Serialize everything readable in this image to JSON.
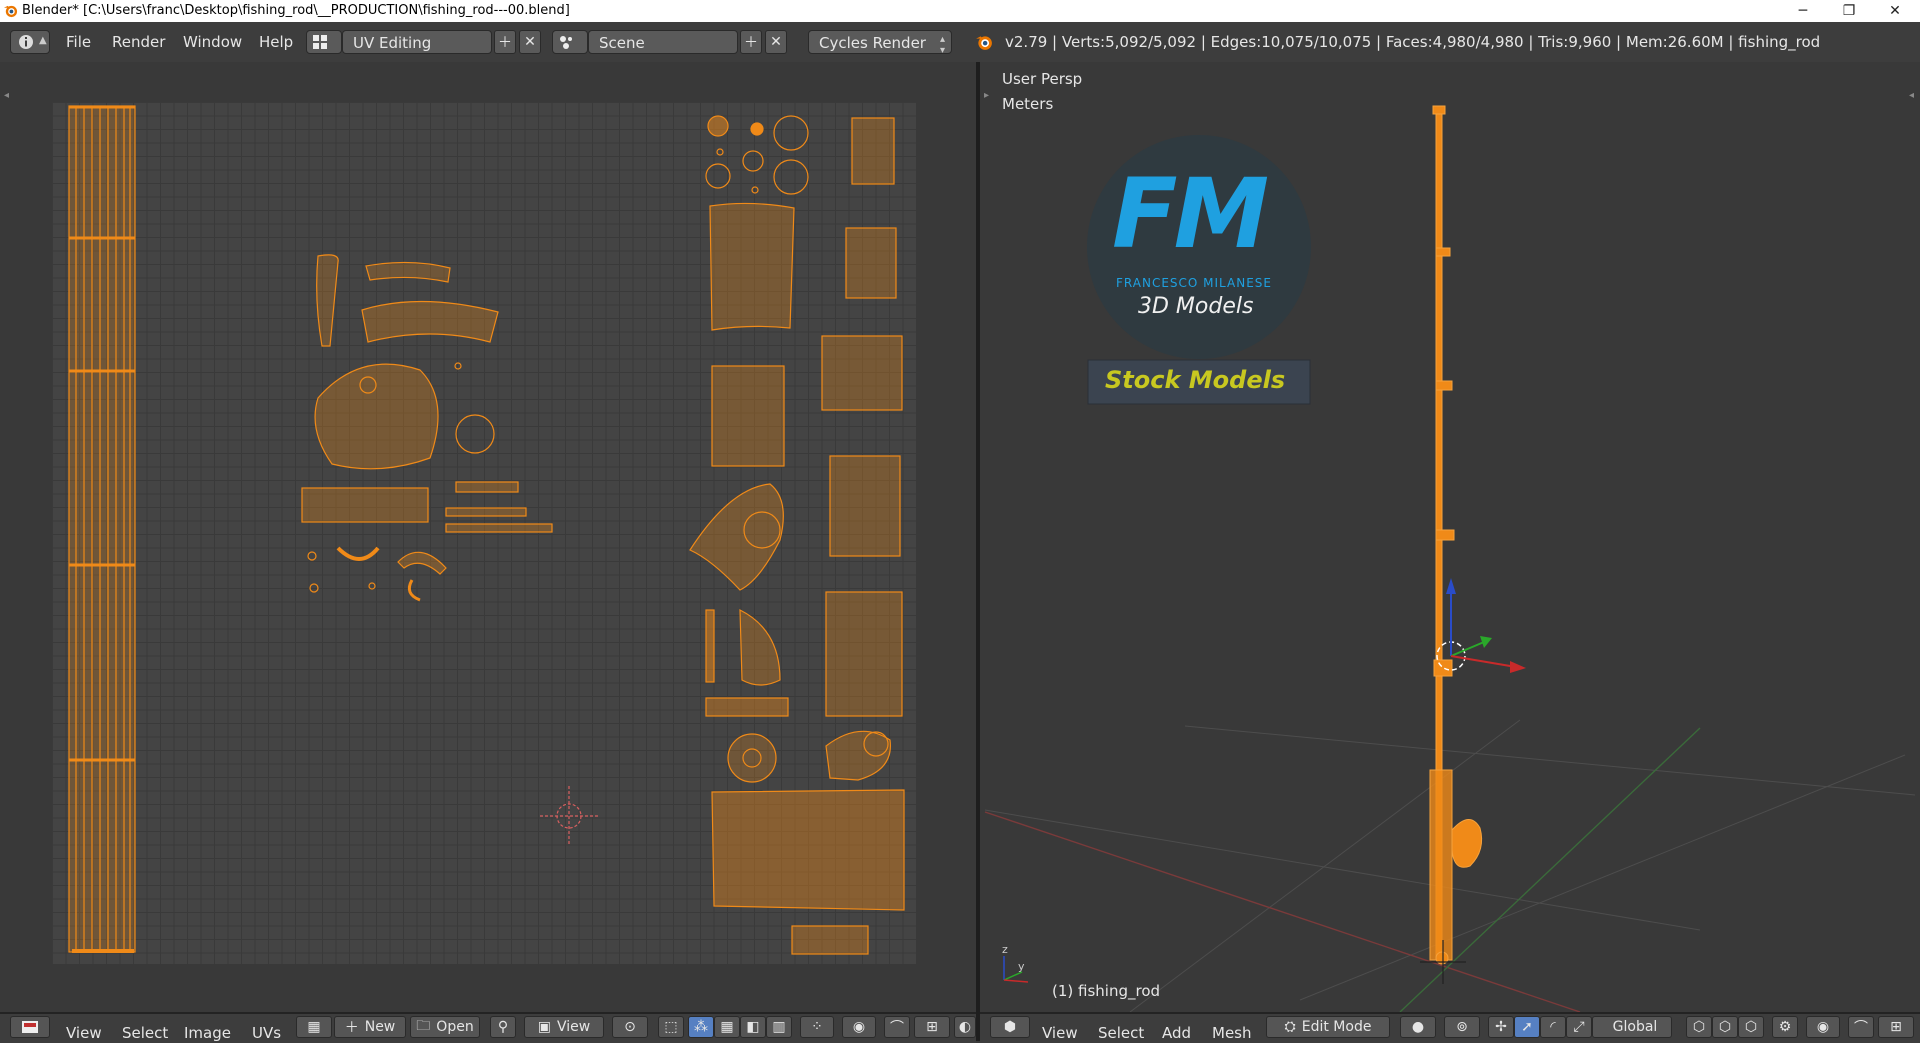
{
  "window": {
    "title": "Blender* [C:\\Users\\franc\\Desktop\\fishing_rod\\__PRODUCTION\\fishing_rod---00.blend]",
    "minimize": "─",
    "restore": "❐",
    "close": "✕"
  },
  "menu": {
    "file": "File",
    "render": "Render",
    "window": "Window",
    "help": "Help"
  },
  "screen_layout": "UV Editing",
  "scene": "Scene",
  "render_engine": "Cycles Render",
  "stats": "v2.79 | Verts:5,092/5,092 | Edges:10,075/10,075 | Faces:4,980/4,980 | Tris:9,960 | Mem:26.60M | fishing_rod",
  "viewport": {
    "view_name": "User Persp",
    "units": "Meters",
    "object_label": "(1) fishing_rod"
  },
  "logo": {
    "letters": "FM",
    "name": "FRANCESCO MILANESE",
    "tagline": "3D Models",
    "banner": "Stock Models"
  },
  "uv_header": {
    "view": "View",
    "select": "Select",
    "image": "Image",
    "uvs": "UVs",
    "new": "New",
    "open": "Open",
    "view2": "View"
  },
  "vp_header": {
    "view": "View",
    "select": "Select",
    "add": "Add",
    "mesh": "Mesh",
    "mode": "Edit Mode",
    "orientation": "Global"
  },
  "colors": {
    "accent_orange": "#f08a18",
    "logo_blue": "#1fa0e0",
    "banner_yellow": "#c8c820"
  }
}
